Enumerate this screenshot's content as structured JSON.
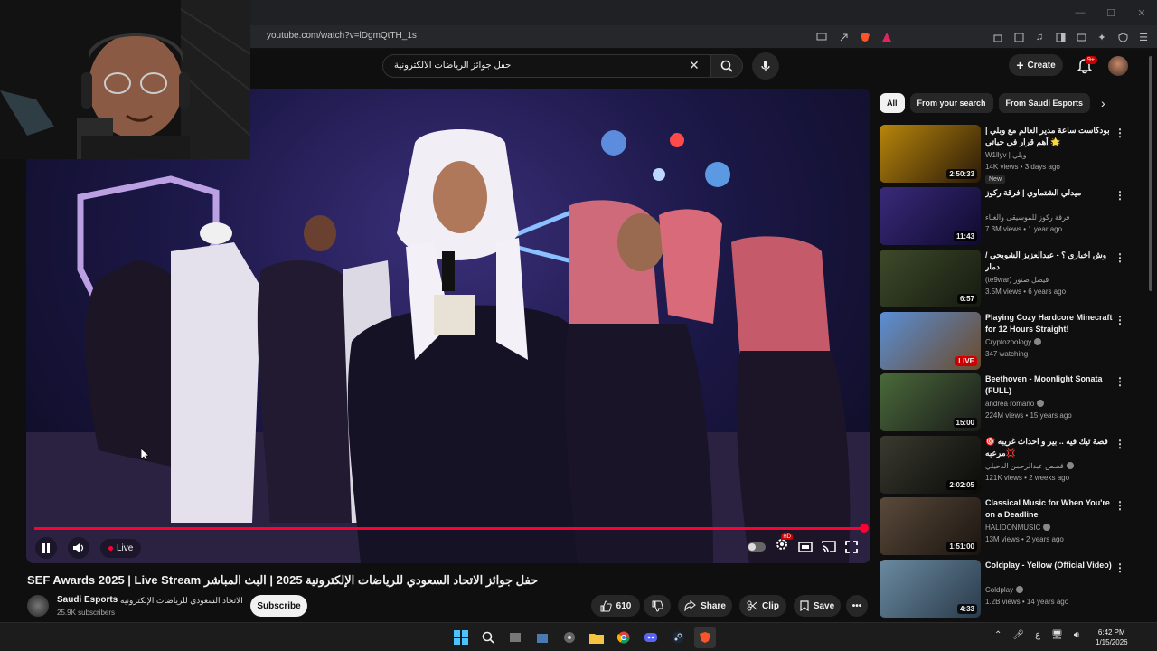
{
  "window": {
    "minimize": "—",
    "maximize": "☐",
    "close": "✕"
  },
  "browser": {
    "url": "youtube.com/watch?v=lDgmQtTH_1s"
  },
  "header": {
    "search_value": "حفل جوائز الرياضات الالكترونية",
    "create_label": "Create",
    "notifications_count": "9+"
  },
  "player": {
    "live_label": "Live",
    "progress": 1.0
  },
  "video": {
    "title": "SEF Awards 2025 | Live Stream حفل جوائز الاتحاد السعودي للرياضات الإلكترونية 2025 | البث المباشر",
    "channel_name": "Saudi Esports",
    "channel_name_ar": "الاتحاد السعودي للرياضات الإلكترونية",
    "subscribers": "25.9K subscribers",
    "subscribe_label": "Subscribe",
    "likes": "610",
    "share_label": "Share",
    "clip_label": "Clip",
    "save_label": "Save"
  },
  "chips": [
    {
      "label": "All"
    },
    {
      "label": "From your search"
    },
    {
      "label": "From Saudi Esports"
    }
  ],
  "recommendations": [
    {
      "title": "بودكاست ساعة مدير العالم مع وبلي | أهم قرار في حياتي 🌟",
      "channel": "W1llyv | وبلي",
      "meta": "14K views • 3 days ago",
      "duration": "2:50:33",
      "badge": "New",
      "verified": false,
      "colors": [
        "#b8860b",
        "#2a1a0a"
      ]
    },
    {
      "title": "ميدلي الشتماوي | فرقة ركوز",
      "channel": "فرقة ركوز للموسيقى والغناء",
      "meta": "7.3M views • 1 year ago",
      "duration": "11:43",
      "badge": "",
      "verified": false,
      "colors": [
        "#3a2a7a",
        "#0e0a2e"
      ]
    },
    {
      "title": "وش اخباري ؟ - عبدالعزيز الشويحي / دمار",
      "channel": "(te9war) فيصل صنور",
      "meta": "3.5M views • 6 years ago",
      "duration": "6:57",
      "badge": "",
      "verified": false,
      "colors": [
        "#3e4a2a",
        "#151a10"
      ]
    },
    {
      "title": "Playing Cozy Hardcore Minecraft for 12 Hours Straight!",
      "channel": "Cryptozoology",
      "meta": "347 watching",
      "duration": "LIVE",
      "badge": "",
      "verified": true,
      "colors": [
        "#5a8fd6",
        "#6b4a2a"
      ]
    },
    {
      "title": "Beethoven - Moonlight Sonata (FULL)",
      "channel": "andrea romano",
      "meta": "224M views • 15 years ago",
      "duration": "15:00",
      "badge": "",
      "verified": true,
      "colors": [
        "#4a6a3a",
        "#1a1a1a"
      ]
    },
    {
      "title": "قصة تيك فيه .. بير و احداث غريبه 🎯 مرعبه💢",
      "channel": "قصص عبدالرحمن الدحيلي",
      "meta": "121K views • 2 weeks ago",
      "duration": "2:02:05",
      "badge": "",
      "verified": true,
      "colors": [
        "#3a3a30",
        "#0a0a08"
      ]
    },
    {
      "title": "Classical Music for When You're on a Deadline",
      "channel": "HALIDONMUSIC",
      "meta": "13M views • 2 years ago",
      "duration": "1:51:00",
      "badge": "",
      "verified": true,
      "colors": [
        "#5a4a3a",
        "#1a1410"
      ]
    },
    {
      "title": "Coldplay - Yellow (Official Video)",
      "channel": "Coldplay",
      "meta": "1.2B views • 14 years ago",
      "duration": "4:33",
      "badge": "",
      "verified": true,
      "colors": [
        "#6a8aa0",
        "#2a3a4a"
      ]
    }
  ],
  "taskbar": {
    "time": "6:42 PM",
    "date": "1/15/2026",
    "lang": "ع"
  }
}
